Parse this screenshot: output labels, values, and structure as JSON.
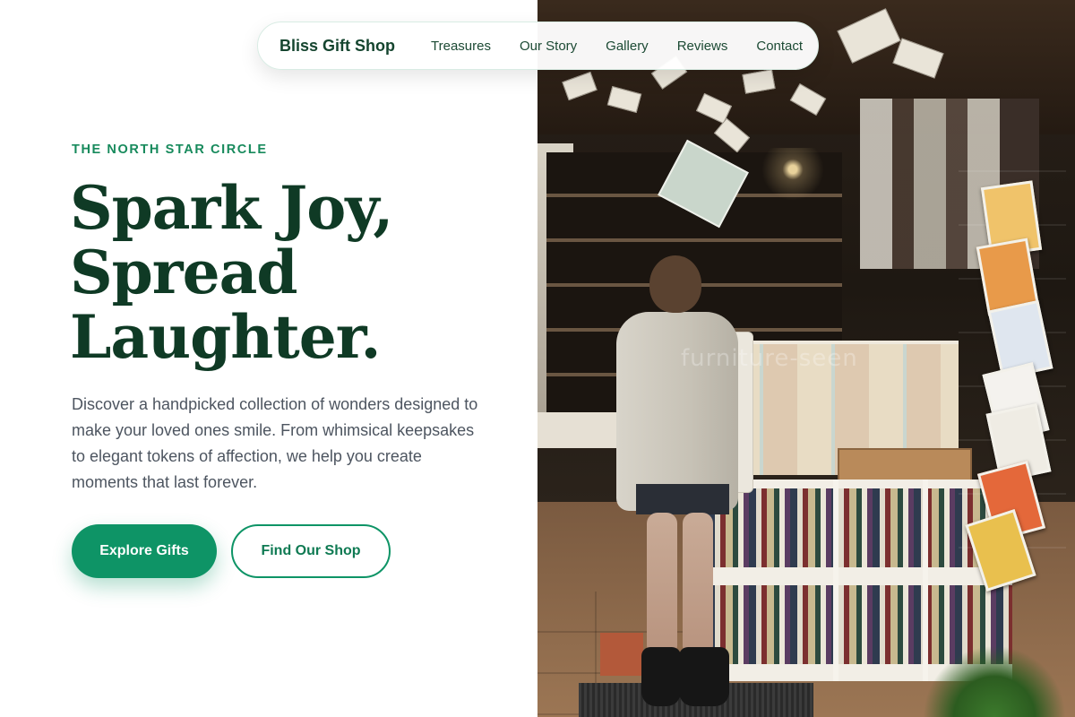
{
  "nav": {
    "brand": "Bliss Gift Shop",
    "links": [
      {
        "label": "Treasures"
      },
      {
        "label": "Our Story"
      },
      {
        "label": "Gallery"
      },
      {
        "label": "Reviews"
      },
      {
        "label": "Contact"
      }
    ]
  },
  "hero": {
    "eyebrow": "THE NORTH STAR CIRCLE",
    "headline_lines": [
      "Spark Joy,",
      "Spread",
      "Laughter."
    ],
    "description": "Discover a handpicked collection of wonders designed to make your loved ones smile. From whimsical keepsakes to elegant tokens of affection, we help you create moments that last forever.",
    "primary_cta": "Explore Gifts",
    "secondary_cta": "Find Our Shop"
  },
  "photo": {
    "subject": "gift-shop-interior-photo",
    "watermark": "furniture-seen"
  },
  "colors": {
    "brand_green": "#0e9466",
    "headline": "#0f3a25",
    "eyebrow": "#178a5c",
    "body_text": "#4d5560"
  }
}
